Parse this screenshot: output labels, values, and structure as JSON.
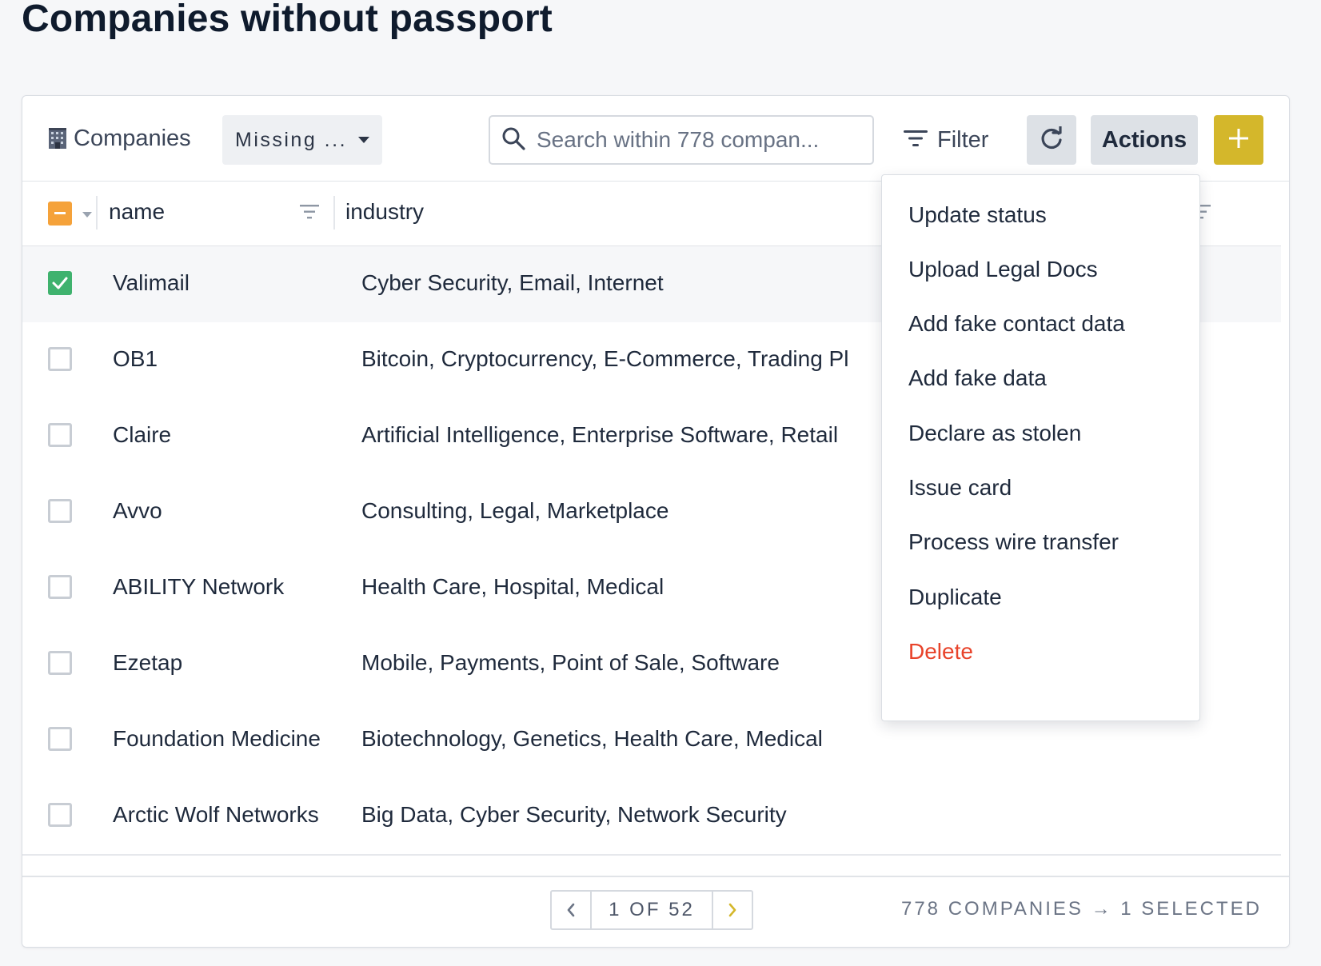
{
  "page": {
    "title": "Companies without passport"
  },
  "toolbar": {
    "entity_label": "Companies",
    "view_select": "Missing ...",
    "search_placeholder": "Search within 778 compan...",
    "filter_label": "Filter",
    "actions_label": "Actions",
    "accent_color": "#d4b72b"
  },
  "table": {
    "columns": [
      "name",
      "industry"
    ],
    "rows": [
      {
        "name": "Valimail",
        "industry": "Cyber Security, Email, Internet",
        "selected": true
      },
      {
        "name": "OB1",
        "industry": "Bitcoin, Cryptocurrency, E-Commerce, Trading Pl",
        "selected": false
      },
      {
        "name": "Claire",
        "industry": "Artificial Intelligence, Enterprise Software, Retail",
        "selected": false
      },
      {
        "name": "Avvo",
        "industry": "Consulting, Legal, Marketplace",
        "selected": false
      },
      {
        "name": "ABILITY Network",
        "industry": "Health Care, Hospital, Medical",
        "selected": false
      },
      {
        "name": "Ezetap",
        "industry": "Mobile, Payments, Point of Sale, Software",
        "selected": false
      },
      {
        "name": "Foundation Medicine",
        "industry": "Biotechnology, Genetics, Health Care, Medical",
        "selected": false
      },
      {
        "name": "Arctic Wolf Networks",
        "industry": "Big Data, Cyber Security, Network Security",
        "selected": false
      }
    ]
  },
  "footer": {
    "page_label": "1 OF 52",
    "count_label": "778 COMPANIES → 1 SELECTED"
  },
  "actions_menu": {
    "items": [
      "Update status",
      "Upload Legal Docs",
      "Add fake contact data",
      "Add fake data",
      "Declare as stolen",
      "Issue card",
      "Process wire transfer",
      "Duplicate"
    ],
    "danger_item": "Delete",
    "danger_color": "#e8432a"
  },
  "icons": [
    "building-icon",
    "search-icon",
    "filter-icon",
    "refresh-icon",
    "plus-icon",
    "column-filter-icon",
    "check-icon",
    "chevron-left-icon",
    "chevron-right-icon"
  ]
}
